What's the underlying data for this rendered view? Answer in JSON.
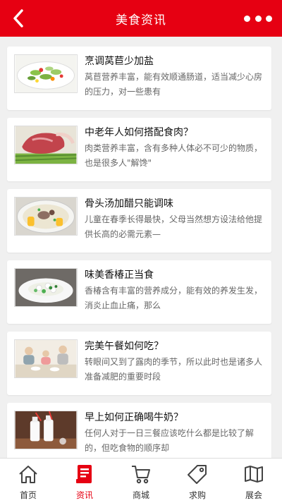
{
  "header": {
    "title": "美食资讯",
    "back_icon": "chevron-left-icon",
    "more_icon": "more-dots-icon",
    "bg_color": "#e60012"
  },
  "articles": [
    {
      "title": "烹调莴苣少加盐",
      "desc": "莴苣营养丰富，能有效顺通肠道，适当减少心房的压力，对一些患有"
    },
    {
      "title": "中老年人如何搭配食肉？",
      "desc": "肉类营养丰富，含有多种人体必不可少的物质，也是很多人\"解馋\""
    },
    {
      "title": "骨头汤加醋只能调味",
      "desc": "儿童在春季长得最快，父母当然想方设法给他提供长高的必需元素—"
    },
    {
      "title": "味美香椿正当食",
      "desc": "香椿含有丰富的营养成分，能有效的养发生发，消炎止血止痛，那么"
    },
    {
      "title": "完美午餐如何吃？",
      "desc": "转眼间又到了露肉的季节，所以此时也是诸多人准备减肥的重要时段"
    },
    {
      "title": "早上如何正确喝牛奶？",
      "desc": "任何人对于一日三餐应该吃什么都是比较了解的，但吃食物的顺序却"
    }
  ],
  "tabbar": {
    "active_color": "#e60012",
    "items": [
      {
        "label": "首页",
        "icon": "home-icon"
      },
      {
        "label": "资讯",
        "icon": "news-icon"
      },
      {
        "label": "商城",
        "icon": "cart-icon"
      },
      {
        "label": "求购",
        "icon": "tag-icon"
      },
      {
        "label": "展会",
        "icon": "map-icon"
      }
    ]
  }
}
